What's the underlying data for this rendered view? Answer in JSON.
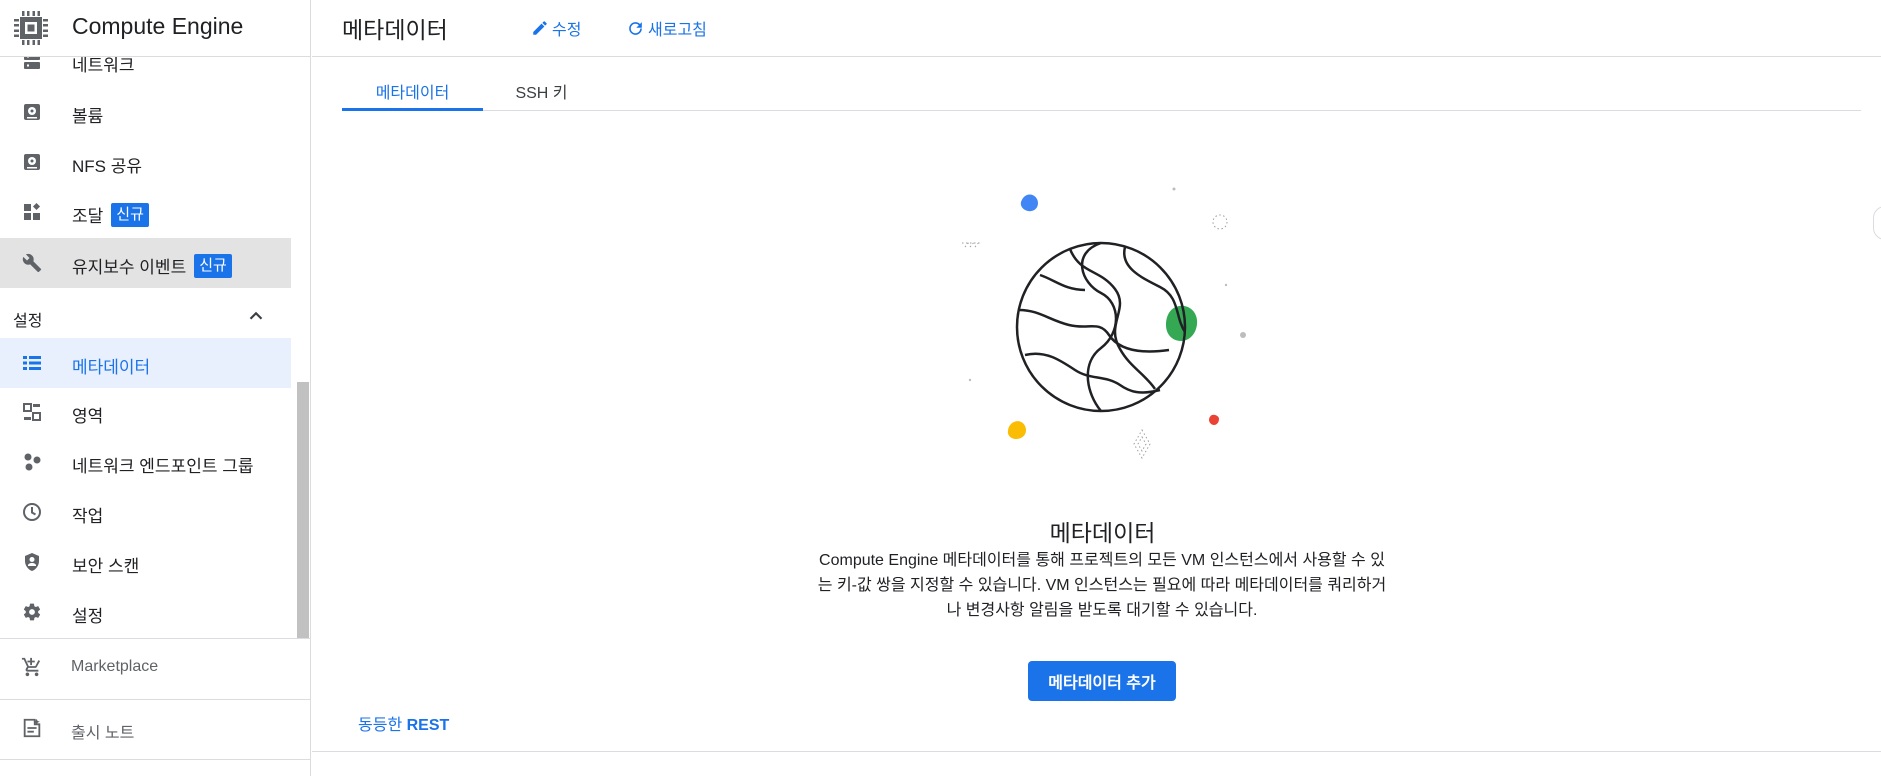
{
  "app": {
    "title": "Compute Engine"
  },
  "sidebar": {
    "items": [
      {
        "label": "네트워크",
        "icon": "storage-icon"
      },
      {
        "label": "볼륨",
        "icon": "disk-icon"
      },
      {
        "label": "NFS 공유",
        "icon": "disk-icon"
      },
      {
        "label": "조달",
        "badge": "신규",
        "icon": "widgets-icon"
      },
      {
        "label": "유지보수 이벤트",
        "badge": "신규",
        "icon": "wrench-icon"
      }
    ],
    "section": {
      "title": "설정"
    },
    "settings_items": [
      {
        "label": "메타데이터",
        "icon": "list-icon"
      },
      {
        "label": "영역",
        "icon": "zones-icon"
      },
      {
        "label": "네트워크 엔드포인트 그룹",
        "icon": "dots-cluster-icon"
      },
      {
        "label": "작업",
        "icon": "clock-icon"
      },
      {
        "label": "보안 스캔",
        "icon": "shield-icon"
      },
      {
        "label": "설정",
        "icon": "gear-icon"
      }
    ],
    "marketplace": {
      "label": "Marketplace",
      "icon": "cart-icon"
    },
    "release_notes": {
      "label": "출시 노트",
      "icon": "notes-icon"
    }
  },
  "header": {
    "title": "메타데이터",
    "edit_label": "수정",
    "refresh_label": "새로고침"
  },
  "tabs": [
    {
      "label": "메타데이터",
      "active": true
    },
    {
      "label": "SSH 키",
      "active": false
    }
  ],
  "empty_state": {
    "title": "메타데이터",
    "description": "Compute Engine 메타데이터를 통해 프로젝트의 모든 VM 인스턴스에서 사용할 수 있는 키-값 쌍을 지정할 수 있습니다. VM 인스턴스는 필요에 따라 메타데이터를 쿼리하거나 변경사항 알림을 받도록 대기할 수 있습니다.",
    "button_label": "메타데이터 추가"
  },
  "rest_link": {
    "prefix": "동등한 ",
    "bold": "REST"
  },
  "colors": {
    "accent": "#1a73e8",
    "active_bg": "#e8f0fe",
    "hover_bg": "#e3e3e3",
    "blob_blue": "#4285f4",
    "blob_green": "#34a853",
    "blob_yellow": "#fbbc04",
    "blob_red": "#ea4335"
  }
}
